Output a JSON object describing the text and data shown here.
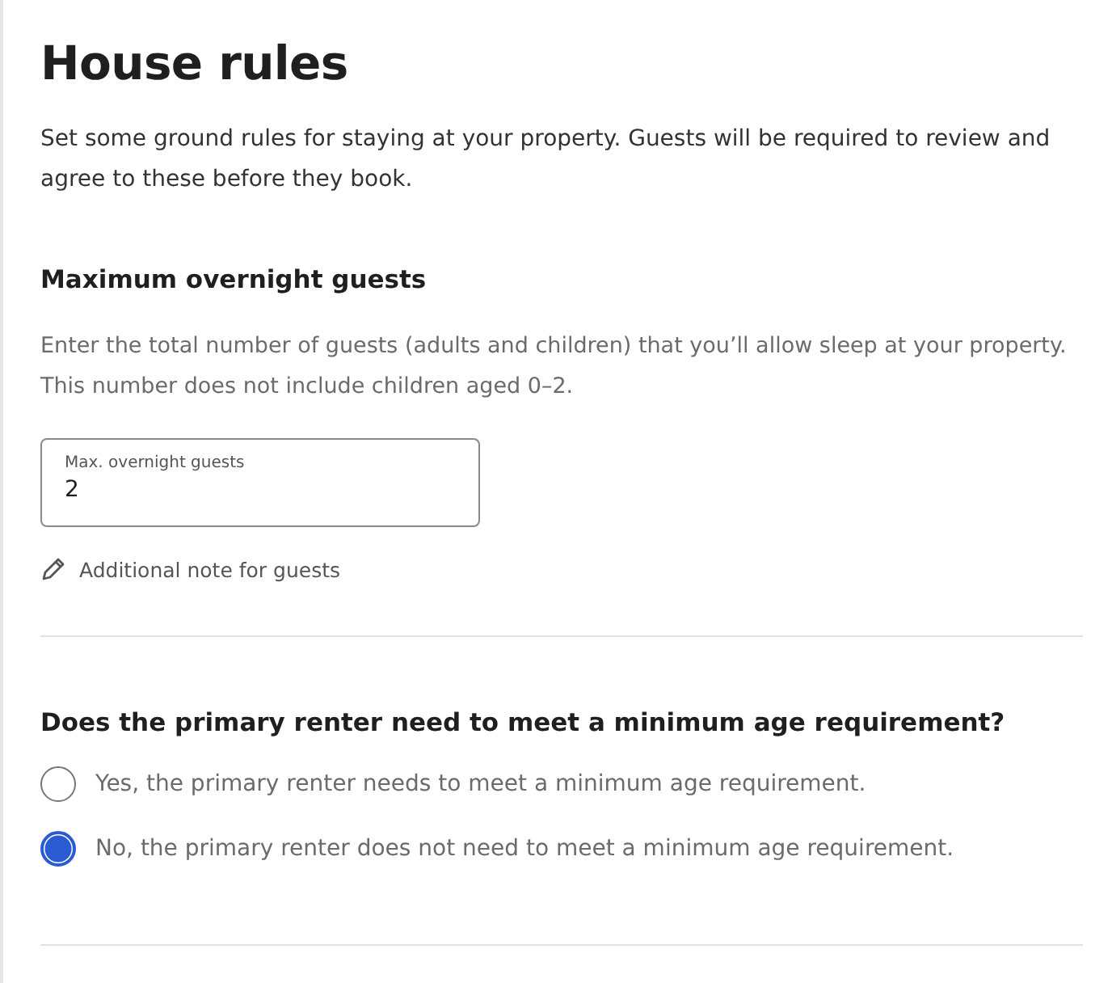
{
  "title": "House rules",
  "intro": "Set some ground rules for staying at your property. Guests will be required to review and agree to these before they book.",
  "guests_section": {
    "heading": "Maximum overnight guests",
    "help": "Enter the total number of guests (adults and children) that you’ll allow sleep at your property. This number does not include children aged 0–2.",
    "field": {
      "label": "Max. overnight guests",
      "value": "2"
    },
    "note_link": "Additional note for guests"
  },
  "age_section": {
    "heading": "Does the primary renter need to meet a minimum age requirement?",
    "options": [
      {
        "label": "Yes, the primary renter needs to meet a minimum age requirement.",
        "selected": false
      },
      {
        "label": "No, the primary renter does not need to meet a minimum age requirement.",
        "selected": true
      }
    ]
  }
}
